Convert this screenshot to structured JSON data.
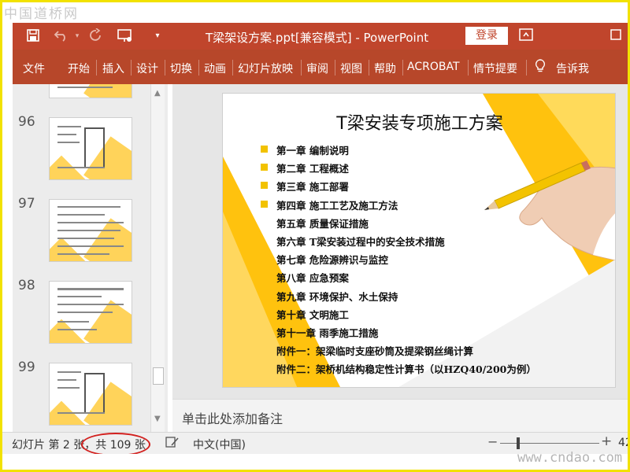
{
  "watermark_top": "中国道桥网",
  "watermark_bottom": "www.cndao.com",
  "titlebar": {
    "document_title": "T梁架设方案.ppt[兼容模式] - PowerPoint",
    "login_label": "登录",
    "icons": [
      "save-icon",
      "undo-icon",
      "redo-icon",
      "present-icon",
      "customize-icon",
      "ribbon-display-icon",
      "maximize-icon"
    ]
  },
  "ribbon": {
    "tabs": [
      "文件",
      "开始",
      "插入",
      "设计",
      "切换",
      "动画",
      "幻灯片放映",
      "审阅",
      "视图",
      "帮助",
      "ACROBAT",
      "情节提要"
    ],
    "tell_me": "告诉我"
  },
  "thumbnails": {
    "numbers": [
      "96",
      "97",
      "98",
      "99"
    ]
  },
  "slide": {
    "title": "T梁安装专项施工方案",
    "items": [
      "第一章  编制说明",
      "第二章  工程概述",
      "第三章  施工部署",
      "第四章 施工工艺及施工方法",
      "第五章  质量保证措施",
      "第六章  T梁安装过程中的安全技术措施",
      "第七章  危险源辨识与监控",
      "第八章  应急预案",
      "第九章  环境保护、水土保持",
      "第十章  文明施工",
      "第十一章  雨季施工措施",
      "附件一：架梁临时支座砂筒及提梁钢丝绳计算",
      "附件二：架桥机结构稳定性计算书（以HZQ40/200为例）"
    ],
    "bulleted_count": 4
  },
  "notes": {
    "placeholder": "单击此处添加备注"
  },
  "status": {
    "slide_count": "幻灯片 第 2 张，共 109 张",
    "language": "中文(中国)",
    "zoom": "42"
  },
  "colors": {
    "title_bar": "#c0452c",
    "ribbon": "#b7472a",
    "accent_yellow": "#ffc20e",
    "highlight_circle": "#d2201e"
  }
}
